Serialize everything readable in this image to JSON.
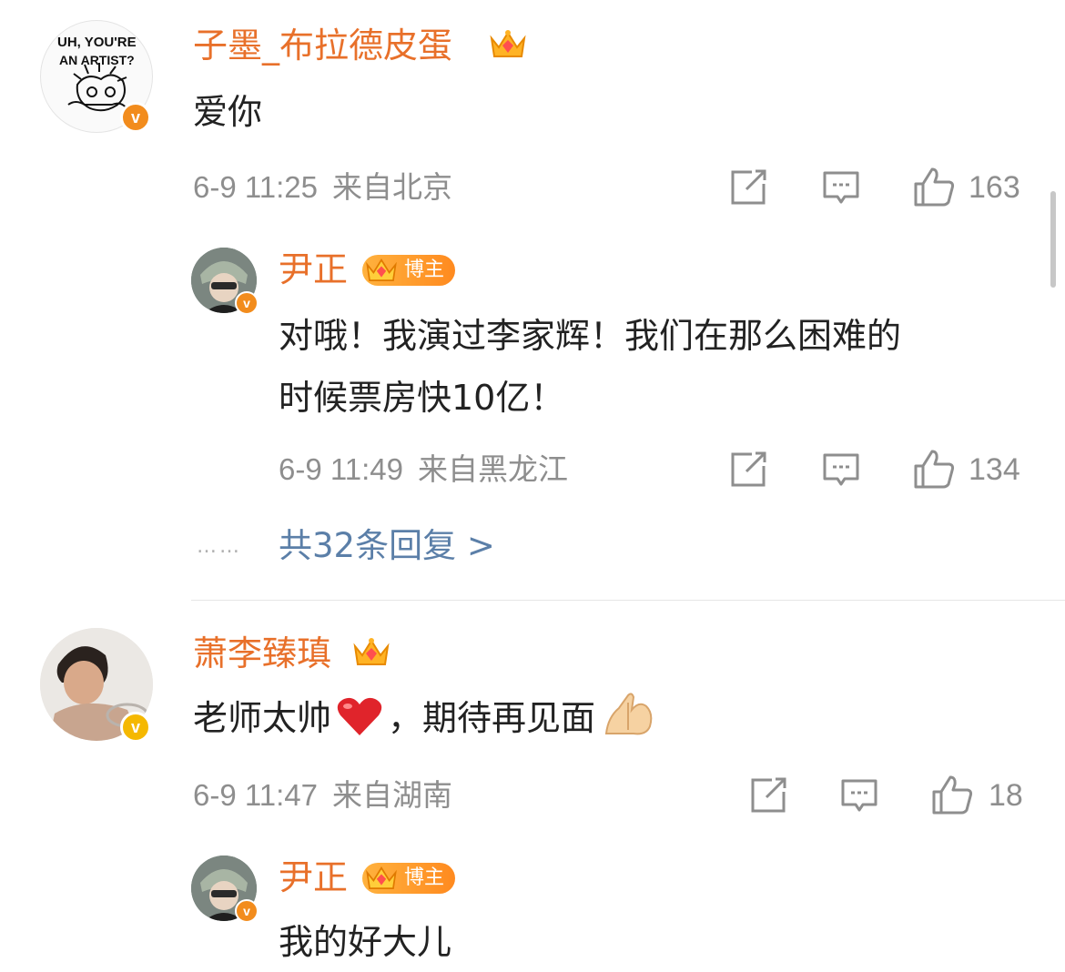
{
  "comments": [
    {
      "user": "子墨_布拉德皮蛋",
      "text": "爱你",
      "avatar_text_1": "UH, YOU'RE",
      "avatar_text_2": "AN ARTIST?",
      "time": "6-9 11:25",
      "location": "来自北京",
      "likes": "163",
      "badge_color": "#f28c1d",
      "reply": {
        "user": "尹正",
        "badge": "博主",
        "text_line1": "对哦！我演过李家辉！我们在那么困难的",
        "text_line2": "时候票房快10亿！",
        "time": "6-9 11:49",
        "location": "来自黑龙江",
        "likes": "134"
      },
      "more_replies": "共32条回复 >"
    },
    {
      "user": "萧李臻瑱",
      "text": "老师太帅",
      "text_after": "，期待再见面",
      "time": "6-9 11:47",
      "location": "来自湖南",
      "likes": "18",
      "badge_color": "#f5b800",
      "reply": {
        "user": "尹正",
        "badge": "博主",
        "text_line1": "我的好大儿"
      }
    }
  ],
  "icons": {
    "share": "share-icon",
    "comment": "comment-icon",
    "like": "thumbs-up-icon",
    "crown": "crown-icon",
    "verified": "verified-v-icon"
  },
  "colors": {
    "username": "#e8702a",
    "meta": "#8e8e8e",
    "link": "#5b7fa8"
  }
}
